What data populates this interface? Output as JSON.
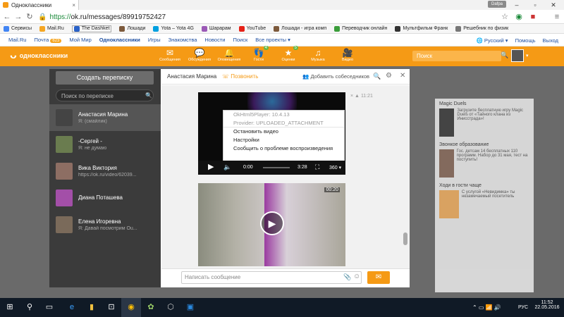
{
  "browser": {
    "tab_title": "Одноклассники",
    "user": "Dafpa",
    "url_scheme": "https://",
    "url_rest": "ok.ru/messages/89919752427",
    "bookmarks": [
      "Сервисы",
      "Mail.Ru",
      "The Dashket",
      "Лошади",
      "Yota – Yota 4G",
      "Шарарам",
      "YouTube",
      "Лошади - игра комп",
      "Переводчик онлайн",
      "Мультфильм Франк",
      "Решебник по физик"
    ]
  },
  "mailru": {
    "items": [
      "Mail.Ru",
      "Почта",
      "Мой Мир",
      "Одноклассники",
      "Игры",
      "Знакомства",
      "Новости",
      "Поиск",
      "Все проекты ▾"
    ],
    "mail_count": "623",
    "language": "Русский ▾",
    "help": "Помощь",
    "logout": "Выход"
  },
  "ok": {
    "logo": "одноклассники",
    "nav": [
      {
        "label": "Сообщения",
        "icon": "envelope-icon"
      },
      {
        "label": "Обсуждения",
        "icon": "chat-icon"
      },
      {
        "label": "Оповещения",
        "icon": "bell-icon"
      },
      {
        "label": "Гости",
        "icon": "footprints-icon",
        "badge": "4"
      },
      {
        "label": "Оценки",
        "icon": "star-icon",
        "badge": "5"
      },
      {
        "label": "Музыка",
        "icon": "music-icon"
      },
      {
        "label": "Видео",
        "icon": "video-icon"
      }
    ],
    "search_placeholder": "Поиск"
  },
  "messenger": {
    "new_conversation": "Создать переписку",
    "search_placeholder": "Поиск по переписке",
    "conversations": [
      {
        "name": "Анастасия Марина",
        "preview": "Я: (смайлик)",
        "avatar_color": "#444"
      },
      {
        "name": "-Сергей -",
        "preview": "Я: не думаю",
        "avatar_color": "#6a7c4f"
      },
      {
        "name": "Вика Виктория",
        "preview": "https://ok.ru/video/62039...",
        "avatar_color": "#8d6e63"
      },
      {
        "name": "Диана Поташева",
        "preview": "",
        "avatar_color": "#a34fa8"
      },
      {
        "name": "Елена Игоревна",
        "preview": "Я: Давай посмотрим Ou...",
        "avatar_color": "#7a6a5a"
      }
    ],
    "chat": {
      "contact": "Анастасия Марина",
      "call": "Позвонить",
      "add": "Добавить собеседников",
      "time": "11:21",
      "menu": [
        "OkHtml5Player: 10.4.13",
        "Provider: UPLOADED_ATTACHMENT",
        "Остановить видео",
        "Настройки",
        "Сообщить о проблеме воспроизведения"
      ],
      "player": {
        "time_current": "0:00",
        "time_total": "3:28",
        "quality": "360 ▾"
      },
      "video2_duration": "00:20",
      "input_placeholder": "Написать сообщение"
    }
  },
  "right_panel": {
    "items": [
      {
        "title": "Magic Duels",
        "text": "Загрузите бесплатную игру Magic Duels от «Тайного клана из Инисстрада»!"
      },
      {
        "title": "Звонкое образование",
        "text": "Гос. детсам 14 бесплатных 110 программ. Набор до 31 мая, тест на поступить!"
      },
      {
        "title": "Ходи в гости чаще",
        "text": "С услугой «Невидимка» ты незамечаемый посетитель"
      }
    ]
  },
  "taskbar": {
    "lang": "РУС",
    "time": "11:52",
    "date": "22.05.2016"
  }
}
